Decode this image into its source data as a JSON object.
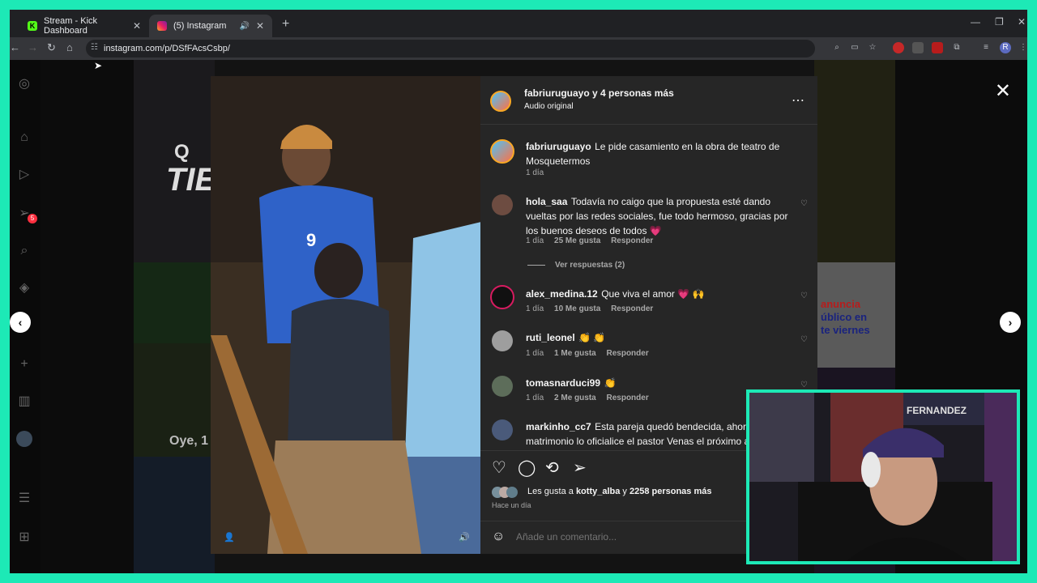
{
  "browser": {
    "tabs": [
      {
        "title": "Stream - Kick Dashboard",
        "active": false,
        "favicon": "kick-icon"
      },
      {
        "title": "(5) Instagram",
        "active": true,
        "favicon": "instagram-icon"
      }
    ],
    "url": "instagram.com/p/DSfFAcsCsbp/"
  },
  "sidebar": {
    "notification_count": "5"
  },
  "background_overlays": {
    "left_text_1": "Q",
    "left_text_2": "TIE",
    "left_text_3": "Oye, 1",
    "right_text_1": "anuncia",
    "right_text_2": "úblico en",
    "right_text_3": "te viernes"
  },
  "post": {
    "header": {
      "author": "fabriuruguayo",
      "collab_text": "y 4 personas más",
      "audio": "Audio original"
    },
    "caption": {
      "user": "fabriuruguayo",
      "text": "Le pide casamiento en la obra de teatro de Mosquetermos",
      "time": "1 día"
    },
    "comments": [
      {
        "user": "hola_saa",
        "text": "Todavía no caigo que la propuesta esté dando vueltas por las redes sociales, fue todo hermoso, gracias por los buenos deseos de todos 💗",
        "time": "1 día",
        "likes": "25 Me gusta",
        "reply": "Responder"
      },
      {
        "user": "alex_medina.12",
        "text": "Que viva el amor 💗 🙌",
        "time": "1 día",
        "likes": "10 Me gusta",
        "reply": "Responder"
      },
      {
        "user": "ruti_leonel",
        "text": "👏 👏",
        "time": "1 día",
        "likes": "1 Me gusta",
        "reply": "Responder"
      },
      {
        "user": "tomasnarduci99",
        "text": "👏",
        "time": "1 día",
        "likes": "2 Me gusta",
        "reply": "Responder"
      },
      {
        "user": "markinho_cc7",
        "text": "Esta pareja quedó bendecida, ahora que el matrimonio lo oficialice el pastor Venas el próximo añ",
        "time": "",
        "likes": "",
        "reply": ""
      }
    ],
    "view_replies": "Ver respuestas (2)",
    "likes_prefix": "Les gusta a",
    "likes_user": "kotty_alba",
    "likes_mid": "y",
    "likes_count": "2258 personas más",
    "posted": "Hace un día",
    "comment_placeholder": "Añade un comentario..."
  },
  "webcam": {
    "sign_text": "FERNANDEZ"
  },
  "colors": {
    "accent_border": "#1de9b6",
    "panel_bg": "#262626",
    "heart_pink": "#ff3b7f"
  }
}
